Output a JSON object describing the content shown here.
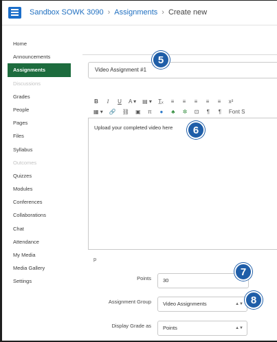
{
  "header": {
    "breadcrumbs": [
      {
        "label": "Sandbox SOWK 3090"
      },
      {
        "label": "Assignments"
      },
      {
        "label": "Create new"
      }
    ],
    "separator": "›"
  },
  "sidebar": {
    "items": [
      {
        "label": "Home",
        "state": "normal"
      },
      {
        "label": "Announcements",
        "state": "normal"
      },
      {
        "label": "Assignments",
        "state": "active"
      },
      {
        "label": "Discussions",
        "state": "muted"
      },
      {
        "label": "Grades",
        "state": "normal"
      },
      {
        "label": "People",
        "state": "normal"
      },
      {
        "label": "Pages",
        "state": "normal"
      },
      {
        "label": "Files",
        "state": "normal"
      },
      {
        "label": "Syllabus",
        "state": "normal"
      },
      {
        "label": "Outcomes",
        "state": "muted"
      },
      {
        "label": "Quizzes",
        "state": "normal"
      },
      {
        "label": "Modules",
        "state": "normal"
      },
      {
        "label": "Conferences",
        "state": "normal"
      },
      {
        "label": "Collaborations",
        "state": "normal"
      },
      {
        "label": "Chat",
        "state": "normal"
      },
      {
        "label": "Attendance",
        "state": "normal"
      },
      {
        "label": "My Media",
        "state": "normal"
      },
      {
        "label": "Media Gallery",
        "state": "normal"
      },
      {
        "label": "Settings",
        "state": "normal"
      }
    ]
  },
  "assignment": {
    "title_value": "Video Assignment #1",
    "editor_text": "Upload your completed video here",
    "editor_path": "p",
    "toolbar_row1": [
      "B",
      "I",
      "U",
      "A ▾",
      "▤ ▾",
      "T̲ₓ",
      "≡",
      "≡",
      "≡",
      "≡",
      "≡",
      "x²"
    ],
    "toolbar_row2": [
      "▦ ▾",
      "🔗",
      "⛓",
      "▣",
      "π",
      "●",
      "♣",
      "✲",
      "⊡",
      "¶",
      "¶",
      "Font S"
    ]
  },
  "form": {
    "points_label": "Points",
    "points_value": "30",
    "group_label": "Assignment Group",
    "group_value": "Video Assignments",
    "display_label": "Display Grade as",
    "display_value": "Points"
  },
  "callouts": {
    "five": "5",
    "six": "6",
    "seven": "7",
    "eight": "8"
  },
  "colors": {
    "brand_blue": "#1f6fc0",
    "nav_active": "#1d6c3e",
    "callout": "#1f5ea8"
  }
}
